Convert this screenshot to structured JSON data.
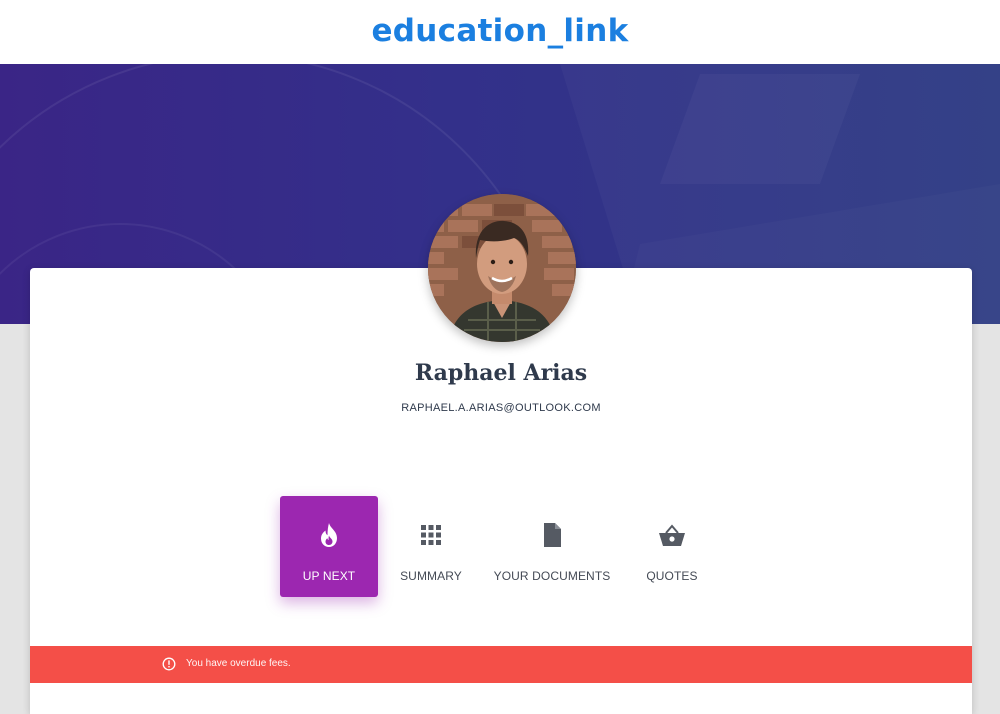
{
  "header": {
    "logo_text": "education_link",
    "brand_color": "#1b7fe0"
  },
  "hero": {
    "gradient_start": "#3a2586",
    "gradient_end": "#2e3b84"
  },
  "profile": {
    "name": "Raphael Arias",
    "email": "RAPHAEL.A.ARIAS@OUTLOOK.COM",
    "avatar_icon": "user-photo"
  },
  "tabs": [
    {
      "label": "UP NEXT",
      "icon": "flame-icon",
      "active": true
    },
    {
      "label": "SUMMARY",
      "icon": "grid-icon",
      "active": false
    },
    {
      "label": "YOUR DOCUMENTS",
      "icon": "document-icon",
      "active": false
    },
    {
      "label": "QUOTES",
      "icon": "basket-icon",
      "active": false
    }
  ],
  "alert": {
    "icon": "info-circle-icon",
    "message": "You have overdue fees.",
    "color": "#f44f48"
  },
  "accent_color": "#9c27b0"
}
